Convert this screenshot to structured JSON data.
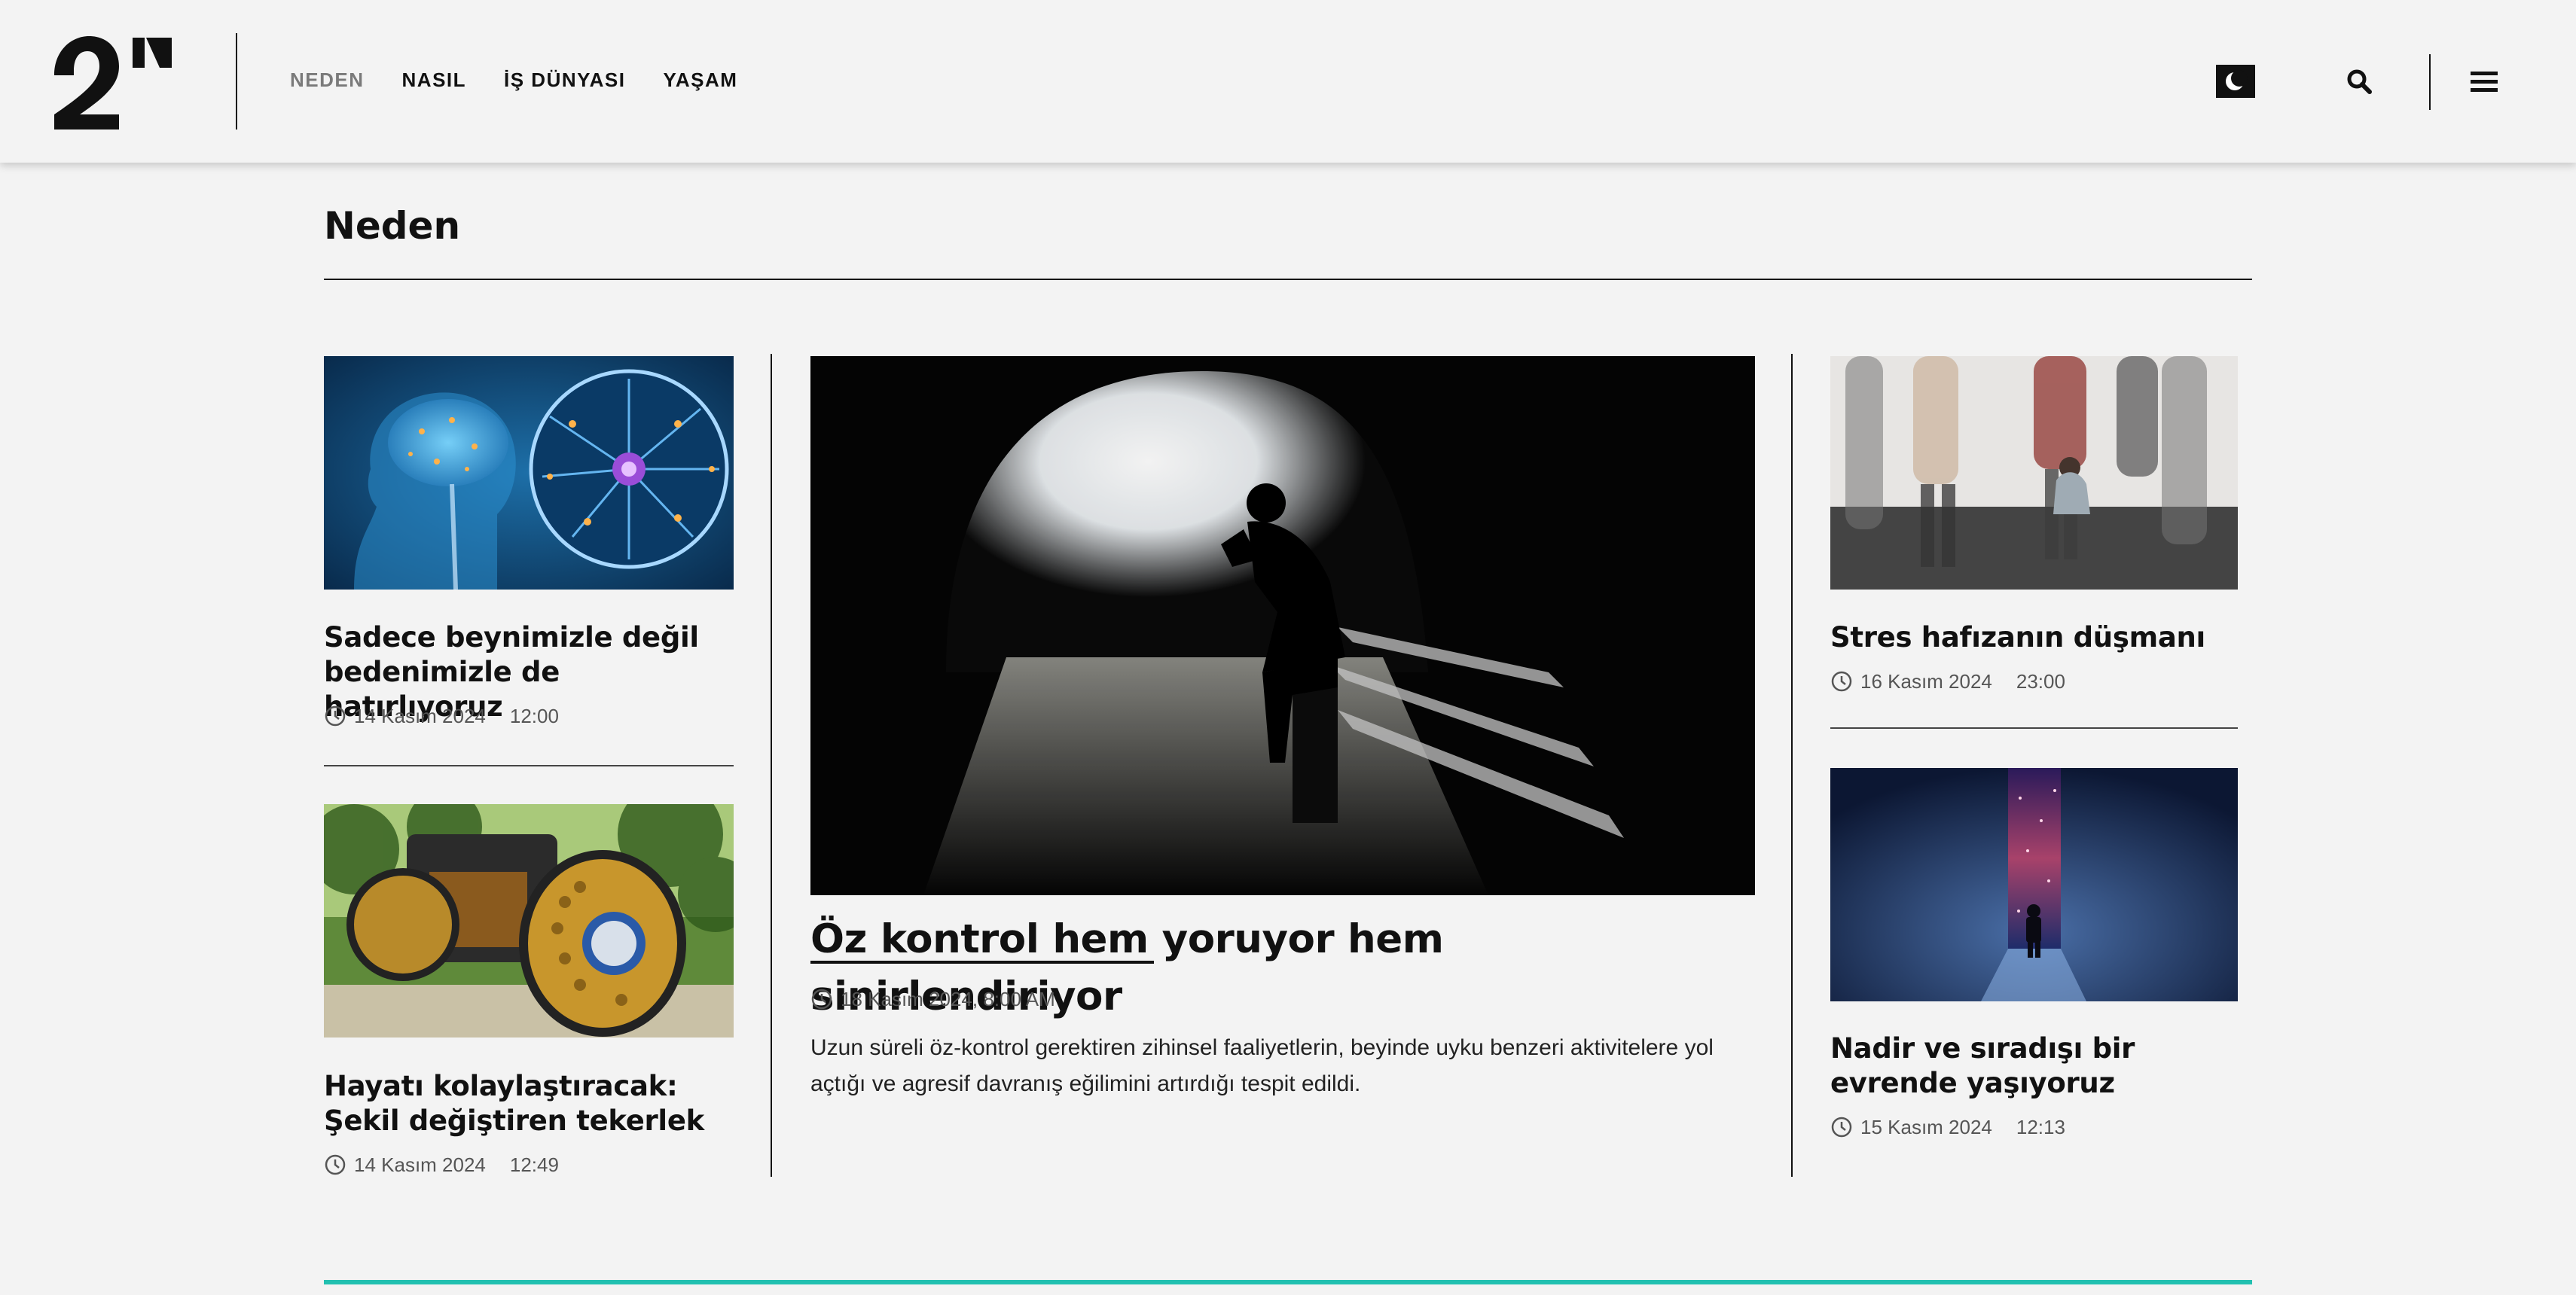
{
  "header": {
    "logo_text": "2N",
    "nav": [
      {
        "label": "NEDEN",
        "active": true
      },
      {
        "label": "NASIL",
        "active": false
      },
      {
        "label": "İŞ DÜNYASI",
        "active": false
      },
      {
        "label": "YAŞAM",
        "active": false
      }
    ],
    "icons": {
      "theme": "moon-icon",
      "search": "search-icon",
      "menu": "hamburger-menu-icon"
    }
  },
  "section": {
    "title": "Neden"
  },
  "left_column": [
    {
      "title": "Sadece beynimizle değil bedenimizle de hatırlıyoruz",
      "date": "14 Kasım 2024",
      "time": "12:00",
      "image": "brain-neuron-image"
    },
    {
      "title": "Hayatı kolaylaştıracak: Şekil değiştiren tekerlek",
      "date": "14 Kasım 2024",
      "time": "12:49",
      "image": "shape-shifting-wheel-image"
    }
  ],
  "feature": {
    "title": "Öz kontrol hem yoruyor hem sinirlendiriyor",
    "datetime": "18 Kasım 2024, 8:00 AM",
    "description": "Uzun süreli öz-kontrol gerektiren zihinsel faaliyetlerin, beyinde uyku benzeri aktivitelere yol açtığı ve agresif davranış eğilimini artırdığı tespit edildi.",
    "image": "man-on-bench-tunnel-image"
  },
  "right_column": [
    {
      "title": "Stres hafızanın düşmanı",
      "date": "16 Kasım 2024",
      "time": "23:00",
      "image": "stressed-person-crowd-image"
    },
    {
      "title": "Nadir ve sıradışı bir evrende yaşıyoruz",
      "date": "15 Kasım 2024",
      "time": "12:13",
      "image": "cosmic-portal-image"
    }
  ],
  "colors": {
    "accent": "#22c0b0",
    "background": "#f3f3f3",
    "text": "#111111"
  }
}
